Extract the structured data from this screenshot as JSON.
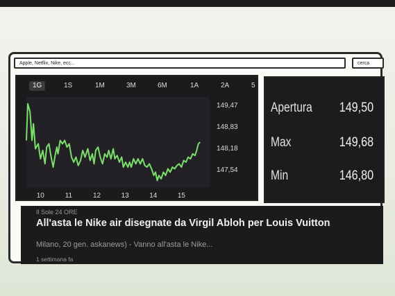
{
  "search": {
    "value": "Apple, Netflix, Nike, ecc...",
    "button_label": "cerca"
  },
  "chart": {
    "tabs": [
      "1G",
      "1S",
      "1M",
      "3M",
      "6M",
      "1A",
      "2A",
      "5"
    ],
    "active_tab": "1G",
    "line_color": "#7be06a"
  },
  "chart_data": {
    "type": "line",
    "x_tick_labels": [
      "10",
      "11",
      "12",
      "13",
      "14",
      "15"
    ],
    "y_tick_labels": [
      "149,47",
      "148,83",
      "148,18",
      "147,54"
    ],
    "ylim": [
      147.0,
      149.7
    ],
    "xlim": [
      9.5,
      16.0
    ],
    "grid": false,
    "series": [
      {
        "values": [
          [
            9.5,
            148.4
          ],
          [
            9.55,
            149.5
          ],
          [
            9.63,
            149.25
          ],
          [
            9.7,
            148.4
          ],
          [
            9.75,
            148.9
          ],
          [
            9.82,
            148.15
          ],
          [
            9.92,
            148.3
          ],
          [
            10.0,
            147.85
          ],
          [
            10.08,
            148.1
          ],
          [
            10.16,
            147.7
          ],
          [
            10.22,
            148.2
          ],
          [
            10.3,
            148.3
          ],
          [
            10.38,
            147.9
          ],
          [
            10.45,
            147.6
          ],
          [
            10.52,
            147.95
          ],
          [
            10.58,
            148.2
          ],
          [
            10.62,
            148.0
          ],
          [
            10.7,
            148.4
          ],
          [
            10.78,
            148.3
          ],
          [
            10.86,
            148.4
          ],
          [
            10.94,
            148.2
          ],
          [
            11.02,
            148.3
          ],
          [
            11.1,
            147.9
          ],
          [
            11.18,
            147.75
          ],
          [
            11.26,
            147.9
          ],
          [
            11.34,
            147.65
          ],
          [
            11.42,
            147.8
          ],
          [
            11.5,
            148.1
          ],
          [
            11.58,
            147.9
          ],
          [
            11.68,
            148.15
          ],
          [
            11.76,
            147.8
          ],
          [
            11.84,
            148.0
          ],
          [
            11.9,
            147.7
          ],
          [
            11.96,
            148.1
          ],
          [
            12.04,
            148.2
          ],
          [
            12.12,
            147.9
          ],
          [
            12.2,
            147.7
          ],
          [
            12.28,
            148.0
          ],
          [
            12.36,
            147.9
          ],
          [
            12.42,
            148.1
          ],
          [
            12.5,
            147.85
          ],
          [
            12.58,
            148.15
          ],
          [
            12.64,
            147.85
          ],
          [
            12.72,
            147.95
          ],
          [
            12.8,
            147.75
          ],
          [
            12.88,
            147.9
          ],
          [
            12.94,
            147.6
          ],
          [
            13.02,
            147.75
          ],
          [
            13.1,
            147.6
          ],
          [
            13.16,
            147.75
          ],
          [
            13.22,
            147.6
          ],
          [
            13.3,
            147.85
          ],
          [
            13.38,
            147.7
          ],
          [
            13.46,
            147.85
          ],
          [
            13.54,
            147.7
          ],
          [
            13.62,
            147.85
          ],
          [
            13.7,
            147.65
          ],
          [
            13.78,
            147.6
          ],
          [
            13.86,
            147.7
          ],
          [
            13.94,
            147.55
          ],
          [
            14.02,
            147.35
          ],
          [
            14.08,
            147.45
          ],
          [
            14.14,
            147.2
          ],
          [
            14.2,
            147.35
          ],
          [
            14.28,
            147.25
          ],
          [
            14.36,
            147.45
          ],
          [
            14.44,
            147.35
          ],
          [
            14.52,
            147.55
          ],
          [
            14.6,
            147.45
          ],
          [
            14.68,
            147.6
          ],
          [
            14.76,
            147.55
          ],
          [
            14.84,
            147.65
          ],
          [
            14.92,
            147.7
          ],
          [
            15.0,
            147.6
          ],
          [
            15.08,
            147.8
          ],
          [
            15.16,
            147.75
          ],
          [
            15.24,
            147.9
          ],
          [
            15.32,
            147.85
          ],
          [
            15.4,
            148.0
          ],
          [
            15.48,
            147.95
          ],
          [
            15.54,
            148.1
          ],
          [
            15.6,
            148.3
          ],
          [
            15.66,
            148.35
          ]
        ]
      }
    ]
  },
  "stats": [
    {
      "label": "Apertura",
      "value": "149,50"
    },
    {
      "label": "Max",
      "value": "149,68"
    },
    {
      "label": "Min",
      "value": "146,80"
    }
  ],
  "news": {
    "source": "Il Sole 24 ORE",
    "title": "All'asta le Nike air disegnate da Virgil Abloh per Louis Vuitton",
    "snippet": "Milano, 20 gen. askanews) - Vanno all'asta le Nike...",
    "time": "1 settimana fa"
  }
}
